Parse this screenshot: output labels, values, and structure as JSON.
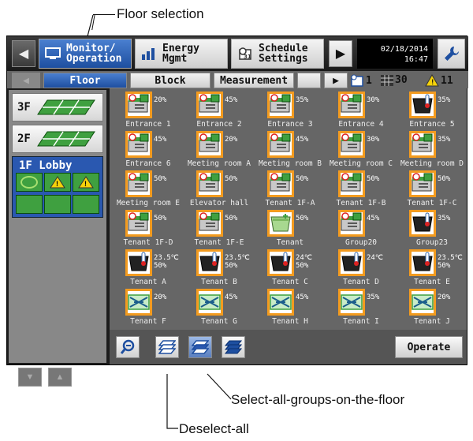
{
  "callouts": {
    "floor_selection": "Floor selection",
    "select_all": "Select-all-groups-on-the-floor",
    "deselect_all": "Deselect-all"
  },
  "topbar": {
    "monitor_line1": "Monitor/",
    "monitor_line2": "Operation",
    "energy_line1": "Energy",
    "energy_line2": "Mgmt",
    "schedule_line1": "Schedule",
    "schedule_line2": "Settings",
    "date": "02/18/2014",
    "time": "16:47"
  },
  "tabs": {
    "floor": "Floor",
    "block": "Block",
    "measurement": "Measurement"
  },
  "status": {
    "schedule_count": "1",
    "group_count": "30",
    "warning_count": "11"
  },
  "floors": {
    "f3": "3F",
    "f2": "2F",
    "lobby": "1F Lobby"
  },
  "units": [
    {
      "name": "Entrance 1",
      "value": "20%",
      "icon": "ventilation-icon"
    },
    {
      "name": "Entrance 2",
      "value": "45%",
      "icon": "ventilation-icon"
    },
    {
      "name": "Entrance 3",
      "value": "35%",
      "icon": "ventilation-icon"
    },
    {
      "name": "Entrance 4",
      "value": "30%",
      "icon": "ventilation-icon"
    },
    {
      "name": "Entrance 5",
      "value": "35%",
      "icon": "dark-unit-icon"
    },
    {
      "name": "Entrance 6",
      "value": "45%",
      "icon": "ventilation-icon"
    },
    {
      "name": "Meeting room A",
      "value": "20%",
      "icon": "ventilation-icon"
    },
    {
      "name": "Meeting room B",
      "value": "45%",
      "icon": "ventilation-icon"
    },
    {
      "name": "Meeting room C",
      "value": "30%",
      "icon": "ventilation-icon"
    },
    {
      "name": "Meeting room D",
      "value": "35%",
      "icon": "ventilation-icon"
    },
    {
      "name": "Meeting room E",
      "value": "50%",
      "icon": "ventilation-icon"
    },
    {
      "name": "Elevator hall",
      "value": "50%",
      "icon": "ventilation-icon"
    },
    {
      "name": "Tenant 1F-A",
      "value": "50%",
      "icon": "ventilation-icon"
    },
    {
      "name": "Tenant 1F-B",
      "value": "50%",
      "icon": "ventilation-icon"
    },
    {
      "name": "Tenant 1F-C",
      "value": "50%",
      "icon": "ventilation-icon"
    },
    {
      "name": "Tenant 1F-D",
      "value": "50%",
      "icon": "ventilation-icon"
    },
    {
      "name": "Tenant 1F-E",
      "value": "50%",
      "icon": "ventilation-icon"
    },
    {
      "name": "Tenant",
      "value": "50%",
      "icon": "group-folder-icon"
    },
    {
      "name": "Group20",
      "value": "45%",
      "icon": "ventilation-icon"
    },
    {
      "name": "Group23",
      "value": "35%",
      "icon": "dark-unit-icon"
    },
    {
      "name": "Tenant A",
      "value": "23.5℃\n50%",
      "icon": "dark-unit-icon"
    },
    {
      "name": "Tenant B",
      "value": "23.5℃\n50%",
      "icon": "dark-unit-icon"
    },
    {
      "name": "Tenant C",
      "value": "24℃\n50%",
      "icon": "dark-unit-icon"
    },
    {
      "name": "Tenant D",
      "value": "24℃",
      "icon": "dark-unit-icon"
    },
    {
      "name": "Tenant E",
      "value": "23.5℃\n50%",
      "icon": "dark-unit-icon"
    },
    {
      "name": "Tenant F",
      "value": "20%",
      "icon": "fan-coil-icon"
    },
    {
      "name": "Tenant G",
      "value": "45%",
      "icon": "fan-coil-icon"
    },
    {
      "name": "Tenant H",
      "value": "45%",
      "icon": "fan-coil-icon"
    },
    {
      "name": "Tenant I",
      "value": "35%",
      "icon": "fan-coil-icon"
    },
    {
      "name": "Tenant J",
      "value": "20%",
      "icon": "fan-coil-icon"
    }
  ],
  "bottombar": {
    "operate": "Operate"
  },
  "colors": {
    "accent_blue": "#2a58b0",
    "selection_orange": "#f39b1f",
    "floor_green": "#3fa040",
    "warning_yellow": "#f5d20a"
  }
}
